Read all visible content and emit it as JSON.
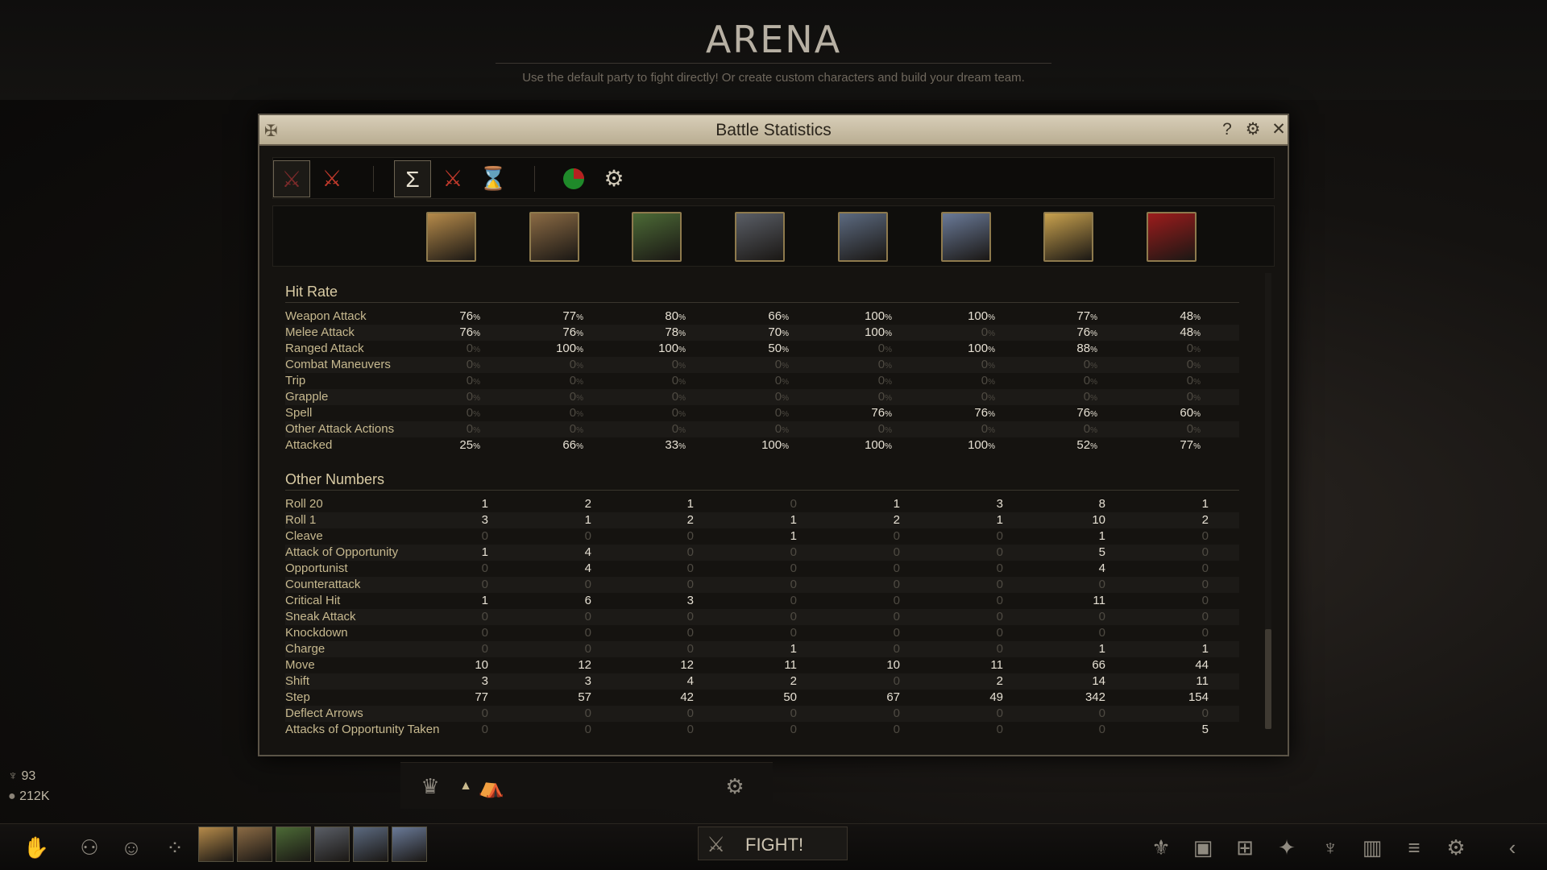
{
  "header": {
    "title": "ARENA",
    "subtitle": "Use the default party to fight directly! Or create custom characters and build your dream team."
  },
  "window": {
    "title": "Battle Statistics",
    "help_icon": "question-icon",
    "settings_icon": "gear-icon",
    "close_icon": "close-icon"
  },
  "toolbar": {
    "buttons": [
      {
        "name": "party-damage-filter",
        "icon": "crossed-swords-faded-icon",
        "active": true
      },
      {
        "name": "enemy-damage-filter",
        "icon": "crossed-swords-red-icon",
        "active": false
      },
      {
        "name": "total-view",
        "icon": "sigma-icon",
        "glyph": "Σ",
        "active": true
      },
      {
        "name": "per-battle-view",
        "icon": "crossed-swords-red-icon",
        "active": false
      },
      {
        "name": "per-round-view",
        "icon": "hourglass-icon",
        "active": false
      },
      {
        "name": "pie-chart-view",
        "icon": "pie-chart-icon",
        "active": false
      },
      {
        "name": "statistics-settings",
        "icon": "gear-icon",
        "active": false
      }
    ]
  },
  "portraits": [
    {
      "name": "portrait-1",
      "color": "#b58a4a"
    },
    {
      "name": "portrait-2",
      "color": "#8a6a44"
    },
    {
      "name": "portrait-3",
      "color": "#4c6a36"
    },
    {
      "name": "portrait-4",
      "color": "#5a5e66"
    },
    {
      "name": "portrait-5",
      "color": "#5c6a80"
    },
    {
      "name": "portrait-6",
      "color": "#6a7a98"
    },
    {
      "name": "portrait-party-total",
      "color": "#c8a14e"
    },
    {
      "name": "portrait-enemies",
      "color": "#9c1c1c"
    }
  ],
  "hit_rate": {
    "title": "Hit Rate",
    "rows": [
      {
        "label": "Weapon Attack",
        "values": [
          "76",
          "77",
          "80",
          "66",
          "100",
          "100",
          "77",
          "48"
        ]
      },
      {
        "label": "Melee Attack",
        "values": [
          "76",
          "76",
          "78",
          "70",
          "100",
          "0",
          "76",
          "48"
        ]
      },
      {
        "label": "Ranged Attack",
        "values": [
          "0",
          "100",
          "100",
          "50",
          "0",
          "100",
          "88",
          "0"
        ]
      },
      {
        "label": "Combat Maneuvers",
        "values": [
          "0",
          "0",
          "0",
          "0",
          "0",
          "0",
          "0",
          "0"
        ]
      },
      {
        "label": "Trip",
        "values": [
          "0",
          "0",
          "0",
          "0",
          "0",
          "0",
          "0",
          "0"
        ]
      },
      {
        "label": "Grapple",
        "values": [
          "0",
          "0",
          "0",
          "0",
          "0",
          "0",
          "0",
          "0"
        ]
      },
      {
        "label": "Spell",
        "values": [
          "0",
          "0",
          "0",
          "0",
          "76",
          "76",
          "76",
          "60"
        ]
      },
      {
        "label": "Other Attack Actions",
        "values": [
          "0",
          "0",
          "0",
          "0",
          "0",
          "0",
          "0",
          "0"
        ]
      },
      {
        "label": "Attacked",
        "values": [
          "25",
          "66",
          "33",
          "100",
          "100",
          "100",
          "52",
          "77"
        ]
      }
    ]
  },
  "other_numbers": {
    "title": "Other Numbers",
    "rows": [
      {
        "label": "Roll 20",
        "values": [
          "1",
          "2",
          "1",
          "0",
          "1",
          "3",
          "8",
          "1"
        ]
      },
      {
        "label": "Roll 1",
        "values": [
          "3",
          "1",
          "2",
          "1",
          "2",
          "1",
          "10",
          "2"
        ]
      },
      {
        "label": "Cleave",
        "values": [
          "0",
          "0",
          "0",
          "1",
          "0",
          "0",
          "1",
          "0"
        ]
      },
      {
        "label": "Attack of Opportunity",
        "values": [
          "1",
          "4",
          "0",
          "0",
          "0",
          "0",
          "5",
          "0"
        ]
      },
      {
        "label": "Opportunist",
        "values": [
          "0",
          "4",
          "0",
          "0",
          "0",
          "0",
          "4",
          "0"
        ]
      },
      {
        "label": "Counterattack",
        "values": [
          "0",
          "0",
          "0",
          "0",
          "0",
          "0",
          "0",
          "0"
        ]
      },
      {
        "label": "Critical Hit",
        "values": [
          "1",
          "6",
          "3",
          "0",
          "0",
          "0",
          "11",
          "0"
        ]
      },
      {
        "label": "Sneak Attack",
        "values": [
          "0",
          "0",
          "0",
          "0",
          "0",
          "0",
          "0",
          "0"
        ]
      },
      {
        "label": "Knockdown",
        "values": [
          "0",
          "0",
          "0",
          "0",
          "0",
          "0",
          "0",
          "0"
        ]
      },
      {
        "label": "Charge",
        "values": [
          "0",
          "0",
          "0",
          "1",
          "0",
          "0",
          "1",
          "1"
        ]
      },
      {
        "label": "Move",
        "values": [
          "10",
          "12",
          "12",
          "11",
          "10",
          "11",
          "66",
          "44"
        ]
      },
      {
        "label": "Shift",
        "values": [
          "3",
          "3",
          "4",
          "2",
          "0",
          "2",
          "14",
          "11"
        ]
      },
      {
        "label": "Step",
        "values": [
          "77",
          "57",
          "42",
          "50",
          "67",
          "49",
          "342",
          "154"
        ]
      },
      {
        "label": "Deflect Arrows",
        "values": [
          "0",
          "0",
          "0",
          "0",
          "0",
          "0",
          "0",
          "0"
        ]
      },
      {
        "label": "Attacks of Opportunity Taken",
        "values": [
          "0",
          "0",
          "0",
          "0",
          "0",
          "0",
          "0",
          "5"
        ]
      }
    ]
  },
  "player": {
    "mythic_count": "93",
    "gold": "212K"
  },
  "bottom": {
    "fight_label": "FIGHT!"
  },
  "colors": {
    "title_bar": "#d8ceb8",
    "label": "#c7b98f",
    "value": "#e6e0d3",
    "zero": "#4e4a42"
  }
}
